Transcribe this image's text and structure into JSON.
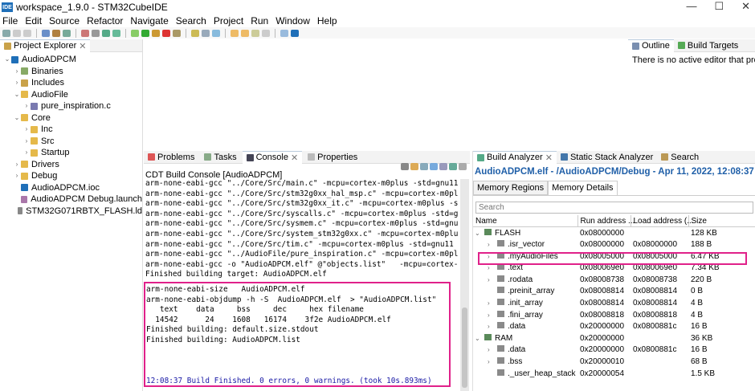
{
  "window": {
    "app_icon": "IDE",
    "title": "workspace_1.9.0 - STM32CubeIDE",
    "min": "—",
    "max": "☐",
    "close": "✕"
  },
  "menu": [
    "File",
    "Edit",
    "Source",
    "Refactor",
    "Navigate",
    "Search",
    "Project",
    "Run",
    "Window",
    "Help"
  ],
  "colors": {
    "highlight": "#e0218a",
    "link_blue": "#1f5fa8",
    "console_blue": "#1a1aa6"
  },
  "explorer": {
    "tab": "Project Explorer",
    "items": [
      {
        "label": "AudioADPCM",
        "level": 0,
        "expanded": true,
        "icon": "project-icon"
      },
      {
        "label": "Binaries",
        "level": 1,
        "expanded": false,
        "icon": "binaries-icon"
      },
      {
        "label": "Includes",
        "level": 1,
        "expanded": false,
        "icon": "includes-icon"
      },
      {
        "label": "AudioFile",
        "level": 1,
        "expanded": true,
        "icon": "folder-icon"
      },
      {
        "label": "pure_inspiration.c",
        "level": 2,
        "expanded": false,
        "icon": "c-file-icon"
      },
      {
        "label": "Core",
        "level": 1,
        "expanded": true,
        "icon": "folder-icon"
      },
      {
        "label": "Inc",
        "level": 2,
        "expanded": false,
        "icon": "folder-icon"
      },
      {
        "label": "Src",
        "level": 2,
        "expanded": false,
        "icon": "folder-icon"
      },
      {
        "label": "Startup",
        "level": 2,
        "expanded": false,
        "icon": "folder-icon"
      },
      {
        "label": "Drivers",
        "level": 1,
        "expanded": false,
        "icon": "folder-icon"
      },
      {
        "label": "Debug",
        "level": 1,
        "expanded": false,
        "icon": "folder-icon"
      },
      {
        "label": "AudioADPCM.ioc",
        "level": 1,
        "expanded": null,
        "icon": "ioc-file-icon"
      },
      {
        "label": "AudioADPCM Debug.launch",
        "level": 1,
        "expanded": null,
        "icon": "launch-file-icon"
      },
      {
        "label": "STM32G071RBTX_FLASH.ld",
        "level": 1,
        "expanded": null,
        "icon": "ld-file-icon"
      }
    ]
  },
  "outline": {
    "tabs": [
      "Outline",
      "Build Targets"
    ],
    "message": "There is no active editor that provides an outline."
  },
  "console": {
    "tabs": [
      "Problems",
      "Tasks",
      "Console",
      "Properties"
    ],
    "title": "CDT Build Console [AudioADPCM]",
    "lines": [
      "arm-none-eabi-gcc \"../Core/Src/main.c\" -mcpu=cortex-m0plus -std=gnu11",
      "arm-none-eabi-gcc \"../Core/Src/stm32g0xx_hal_msp.c\" -mcpu=cortex-m0pl",
      "arm-none-eabi-gcc \"../Core/Src/stm32g0xx_it.c\" -mcpu=cortex-m0plus -s",
      "arm-none-eabi-gcc \"../Core/Src/syscalls.c\" -mcpu=cortex-m0plus -std=g",
      "arm-none-eabi-gcc \"../Core/Src/sysmem.c\" -mcpu=cortex-m0plus -std=gnu",
      "arm-none-eabi-gcc \"../Core/Src/system_stm32g0xx.c\" -mcpu=cortex-m0plu",
      "arm-none-eabi-gcc \"../Core/Src/tim.c\" -mcpu=cortex-m0plus -std=gnu11",
      "arm-none-eabi-gcc \"../AudioFile/pure_inspiration.c\" -mcpu=cortex-m0pl",
      "arm-none-eabi-gcc -o \"AudioADPCM.elf\" @\"objects.list\"   -mcpu=cortex-",
      "Finished building target: AudioADPCM.elf"
    ],
    "boxed_lines": [
      "arm-none-eabi-size   AudioADPCM.elf",
      "arm-none-eabi-objdump -h -S  AudioADPCM.elf  > \"AudioADPCM.list\"",
      "   text    data     bss     dec     hex filename",
      "  14542      24    1608   16174    3f2e AudioADPCM.elf",
      "Finished building: default.size.stdout",
      "Finished building: AudioADPCM.list",
      "",
      "",
      "",
      "12:08:37 Build Finished. 0 errors, 0 warnings. (took 10s.893ms)"
    ]
  },
  "build": {
    "tabs": [
      "Build Analyzer",
      "Static Stack Analyzer",
      "Search"
    ],
    "header": "AudioADPCM.elf - /AudioADPCM/Debug - Apr 11, 2022, 12:08:37 PM",
    "subtabs": [
      "Memory Regions",
      "Memory Details"
    ],
    "search_placeholder": "Search",
    "columns": [
      "Name",
      "Run address ...",
      "Load address (...",
      "Size"
    ],
    "rows": [
      {
        "name": "FLASH",
        "level": 0,
        "exp": "expanded",
        "run": "0x08000000",
        "load": "",
        "size": "128 KB"
      },
      {
        "name": ".isr_vector",
        "level": 1,
        "exp": "collapsed",
        "run": "0x08000000",
        "load": "0x08000000",
        "size": "188 B"
      },
      {
        "name": ".myAudioFiles",
        "level": 1,
        "exp": "collapsed",
        "run": "0x08005000",
        "load": "0x08005000",
        "size": "6.47 KB",
        "highlight": true
      },
      {
        "name": ".text",
        "level": 1,
        "exp": "collapsed",
        "run": "0x080069e0",
        "load": "0x080069e0",
        "size": "7.34 KB"
      },
      {
        "name": ".rodata",
        "level": 1,
        "exp": "collapsed",
        "run": "0x08008738",
        "load": "0x08008738",
        "size": "220 B"
      },
      {
        "name": ".preinit_array",
        "level": 1,
        "exp": "none",
        "run": "0x08008814",
        "load": "0x08008814",
        "size": "0 B"
      },
      {
        "name": ".init_array",
        "level": 1,
        "exp": "collapsed",
        "run": "0x08008814",
        "load": "0x08008814",
        "size": "4 B"
      },
      {
        "name": ".fini_array",
        "level": 1,
        "exp": "collapsed",
        "run": "0x08008818",
        "load": "0x08008818",
        "size": "4 B"
      },
      {
        "name": ".data",
        "level": 1,
        "exp": "collapsed",
        "run": "0x20000000",
        "load": "0x0800881c",
        "size": "16 B"
      },
      {
        "name": "RAM",
        "level": 0,
        "exp": "expanded",
        "run": "0x20000000",
        "load": "",
        "size": "36 KB"
      },
      {
        "name": ".data",
        "level": 1,
        "exp": "collapsed",
        "run": "0x20000000",
        "load": "0x0800881c",
        "size": "16 B"
      },
      {
        "name": ".bss",
        "level": 1,
        "exp": "collapsed",
        "run": "0x20000010",
        "load": "",
        "size": "68 B"
      },
      {
        "name": "._user_heap_stack",
        "level": 1,
        "exp": "none",
        "run": "0x20000054",
        "load": "",
        "size": "1.5 KB"
      }
    ]
  }
}
